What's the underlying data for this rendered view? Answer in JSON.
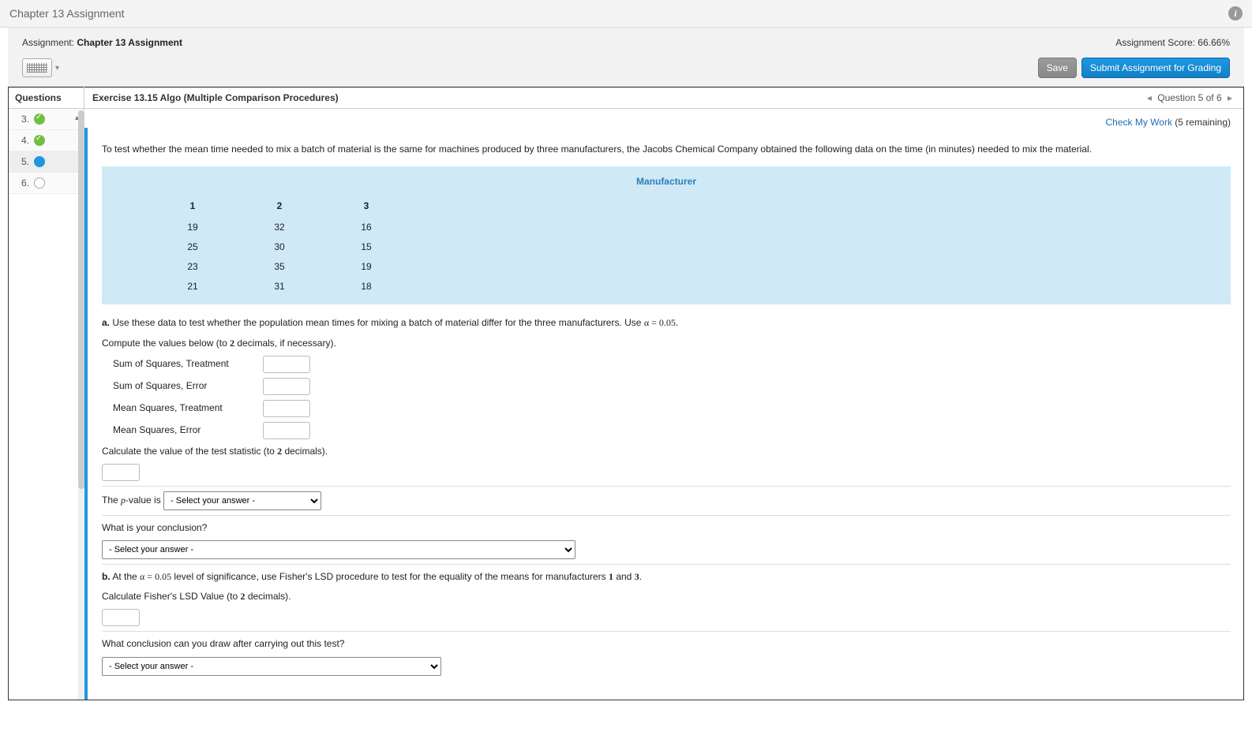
{
  "header": {
    "title": "Chapter 13 Assignment"
  },
  "assign": {
    "label": "Assignment:",
    "name": "Chapter 13 Assignment",
    "score_label": "Assignment Score:",
    "score_value": "66.66%",
    "save_label": "Save",
    "submit_label": "Submit Assignment for Grading"
  },
  "sidebar": {
    "header": "Questions",
    "items": [
      {
        "num": "3.",
        "status": "ok"
      },
      {
        "num": "4.",
        "status": "ok"
      },
      {
        "num": "5.",
        "status": "current"
      },
      {
        "num": "6.",
        "status": "empty"
      }
    ]
  },
  "content": {
    "exercise_title": "Exercise 13.15 Algo (Multiple Comparison Procedures)",
    "pager_text": "Question 5 of 6",
    "check_link": "Check My Work",
    "check_remaining": "(5 remaining)",
    "intro": "To test whether the mean time needed to mix a batch of material is the same for machines produced by three manufacturers, the Jacobs Chemical Company obtained the following data on the time (in minutes) needed to mix the material.",
    "table": {
      "title": "Manufacturer",
      "heads": [
        "1",
        "2",
        "3"
      ],
      "rows": [
        [
          "19",
          "32",
          "16"
        ],
        [
          "25",
          "30",
          "15"
        ],
        [
          "23",
          "35",
          "19"
        ],
        [
          "21",
          "31",
          "18"
        ]
      ]
    },
    "part_a_prefix": "a.",
    "part_a_text_1": "Use these data to test whether the population mean times for mixing a batch of material differ for the three manufacturers. Use ",
    "alpha_expr": "α = 0.05",
    "period": ".",
    "compute_line_pre": "Compute the values below (to ",
    "two": "2",
    "compute_line_post": " decimals, if necessary).",
    "fields": {
      "sst": "Sum of Squares, Treatment",
      "sse": "Sum of Squares, Error",
      "mst": "Mean Squares, Treatment",
      "mse": "Mean Squares, Error"
    },
    "test_stat_pre": "Calculate the value of the test statistic (to ",
    "test_stat_post": " decimals).",
    "pvalue_pre": "The ",
    "pvalue_p": "p",
    "pvalue_post": "-value is",
    "select_placeholder": "- Select your answer -",
    "conclusion_q": "What is your conclusion?",
    "part_b_prefix": "b.",
    "part_b_pre": " At the ",
    "part_b_mid": " level of significance, use Fisher's LSD procedure to test for the equality of the means for manufacturers ",
    "one": "1",
    "and": " and ",
    "three": "3",
    "lsd_pre": "Calculate Fisher's LSD Value (to ",
    "lsd_post": " decimals).",
    "final_q": "What conclusion can you draw after carrying out this test?"
  },
  "chart_data": {
    "type": "table",
    "title": "Manufacturer",
    "categories": [
      "1",
      "2",
      "3"
    ],
    "series": [
      {
        "name": "Manufacturer 1",
        "values": [
          19,
          25,
          23,
          21
        ]
      },
      {
        "name": "Manufacturer 2",
        "values": [
          32,
          30,
          35,
          31
        ]
      },
      {
        "name": "Manufacturer 3",
        "values": [
          16,
          15,
          19,
          18
        ]
      }
    ]
  }
}
